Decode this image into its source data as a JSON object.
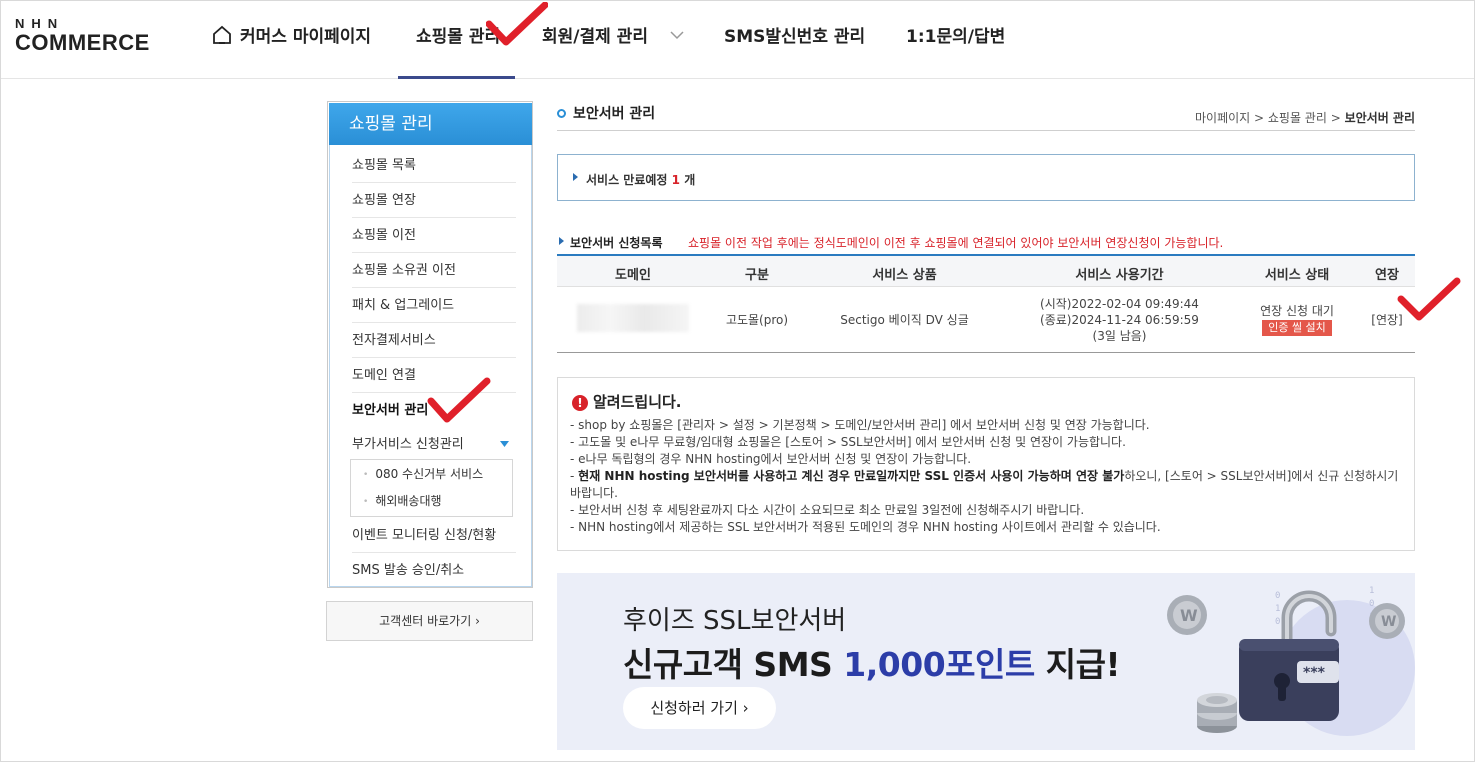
{
  "header": {
    "logo_top": "NHN",
    "logo_bottom": "COMMERCE",
    "nav": [
      {
        "label": "커머스 마이페이지"
      },
      {
        "label": "쇼핑몰 관리"
      },
      {
        "label": "회원/결제 관리"
      },
      {
        "label": "SMS발신번호 관리"
      },
      {
        "label": "1:1문의/답변"
      }
    ],
    "active_nav": "쇼핑몰 관리"
  },
  "sidebar": {
    "title": "쇼핑몰 관리",
    "items": [
      {
        "label": "쇼핑몰 목록"
      },
      {
        "label": "쇼핑몰 연장"
      },
      {
        "label": "쇼핑몰 이전"
      },
      {
        "label": "쇼핑몰 소유권 이전"
      },
      {
        "label": "패치 & 업그레이드"
      },
      {
        "label": "전자결제서비스"
      },
      {
        "label": "도메인 연결"
      },
      {
        "label": "보안서버 관리"
      },
      {
        "label": "부가서비스 신청관리"
      },
      {
        "label": "이벤트 모니터링 신청/현황"
      },
      {
        "label": "SMS 발송 승인/취소"
      }
    ],
    "sub_items": [
      {
        "label": "080 수신거부 서비스"
      },
      {
        "label": "해외배송대행"
      }
    ],
    "cs_button": "고객센터 바로가기 ›"
  },
  "page": {
    "title": "보안서버 관리",
    "breadcrumb": [
      "마이페이지",
      "쇼핑몰 관리",
      "보안서버 관리"
    ],
    "breadcrumb_sep": " > ",
    "expire_prefix": "서비스 만료예정",
    "expire_count": "1",
    "expire_suffix": "개",
    "list_title": "보안서버 신청목록",
    "list_warning": "쇼핑몰 이전 작업 후에는 정식도메인이 이전 후 쇼핑몰에 연결되어 있어야 보안서버 연장신청이 가능합니다."
  },
  "table": {
    "headers": [
      "도메인",
      "구분",
      "서비스 상품",
      "서비스 사용기간",
      "서비스 상태",
      "연장"
    ],
    "rows": [
      {
        "domain": "",
        "type": "고도몰(pro)",
        "product": "Sectigo 베이직 DV 싱글",
        "start": "(시작)2022-02-04 09:49:44",
        "end": "(종료)2024-11-24 06:59:59",
        "remaining": "(3일 남음)",
        "status": "연장 신청 대기",
        "status_badge": "인증 씰 설치",
        "extend": "[연장]"
      }
    ]
  },
  "notice": {
    "title": "알려드립니다.",
    "lines": [
      "- shop by 쇼핑몰은 [관리자 > 설정 > 기본정책 > 도메인/보안서버 관리] 에서 보안서버 신청 및 연장 가능합니다.",
      "- 고도몰 및 e나무 무료형/임대형 쇼핑몰은 [스토어 > SSL보안서버] 에서 보안서버 신청 및 연장이 가능합니다.",
      "- e나무 독립형의 경우 NHN hosting에서 보안서버 신청 및 연장이 가능합니다."
    ],
    "line4_bold": "현재 NHN hosting 보안서버를 사용하고 계신 경우 만료일까지만 SSL 인증서 사용이 가능하며 연장 불가",
    "line4_rest": "하오니, [스토어 > SSL보안서버]에서 신규 신청하시기 바랍니다.",
    "line5": "- 보안서버 신청 후 세팅완료까지 다소 시간이 소요되므로 최소 만료일 3일전에 신청해주시기 바랍니다.",
    "line6": "- NHN hosting에서 제공하는 SSL 보안서버가 적용된 도메인의 경우 NHN hosting 사이트에서 관리할 수 있습니다."
  },
  "banner": {
    "line1": "후이즈 SSL보안서버",
    "line2_prefix": "신규고객 SMS ",
    "line2_highlight": "1,000포인트",
    "line2_suffix": " 지급!",
    "button": "신청하러 가기 ›",
    "lock_text": "***"
  },
  "colors": {
    "accent": "#2a8fd6",
    "nav_active": "#3b4a8c",
    "warning_red": "#d8232a",
    "badge_red": "#e4574a",
    "banner_bg": "#ebeef8",
    "banner_highlight": "#2c3da8",
    "annotation_check": "#e0202a"
  }
}
